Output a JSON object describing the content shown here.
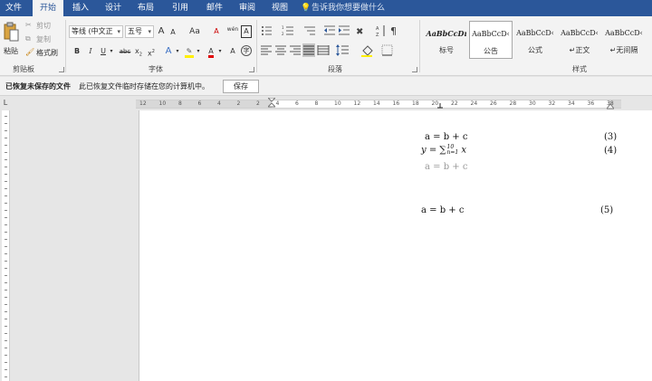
{
  "tabs": [
    "文件",
    "开始",
    "插入",
    "设计",
    "布局",
    "引用",
    "邮件",
    "审阅",
    "视图"
  ],
  "active_tab": "开始",
  "tell_me": "告诉我你想要做什么",
  "clipboard": {
    "paste": "粘贴",
    "cut": "剪切",
    "copy": "复制",
    "format_painter": "格式刷",
    "label": "剪贴板"
  },
  "font": {
    "family": "等线 (中文正",
    "size": "五号",
    "grow": "A",
    "shrink": "A",
    "case": "Aa",
    "wen": "wén",
    "bold": "B",
    "italic": "I",
    "underline": "U",
    "strike": "abc",
    "subscript": "x",
    "superscript": "x",
    "color_letter": "A",
    "label": "字体"
  },
  "paragraph": {
    "label": "段落"
  },
  "styles": {
    "label": "样式",
    "items": [
      {
        "sample": "AaBbCcDı",
        "name": "标号"
      },
      {
        "sample": "AaBbCcD‹",
        "name": "公告"
      },
      {
        "sample": "AaBbCcD‹",
        "name": "公式"
      },
      {
        "sample": "AaBbCcD‹",
        "name": "↵正文"
      },
      {
        "sample": "AaBbCcD‹",
        "name": "↵无间隔"
      }
    ],
    "selected": 1
  },
  "infobar": {
    "title": "已恢复未保存的文件",
    "message": "此已恢复文件临时存储在您的计算机中。",
    "save": "保存"
  },
  "ruler_corner": "L",
  "ruler_numbers": [
    "12",
    "10",
    "8",
    "6",
    "4",
    "2",
    "2",
    "4",
    "6",
    "8",
    "10",
    "12",
    "14",
    "16",
    "18",
    "20",
    "22",
    "24",
    "26",
    "28",
    "30",
    "32",
    "34",
    "36",
    "38"
  ],
  "document": {
    "eq1": "a = b + c",
    "eq1_num": "(3)",
    "eq2_prefix": "y = ∑",
    "eq2_sup": "10",
    "eq2_sub": "n=1",
    "eq2_suffix": " x",
    "eq2_num": "(4)",
    "eq3": "a = b + c",
    "eq4": "a = b + c",
    "eq4_num": "(5)"
  }
}
